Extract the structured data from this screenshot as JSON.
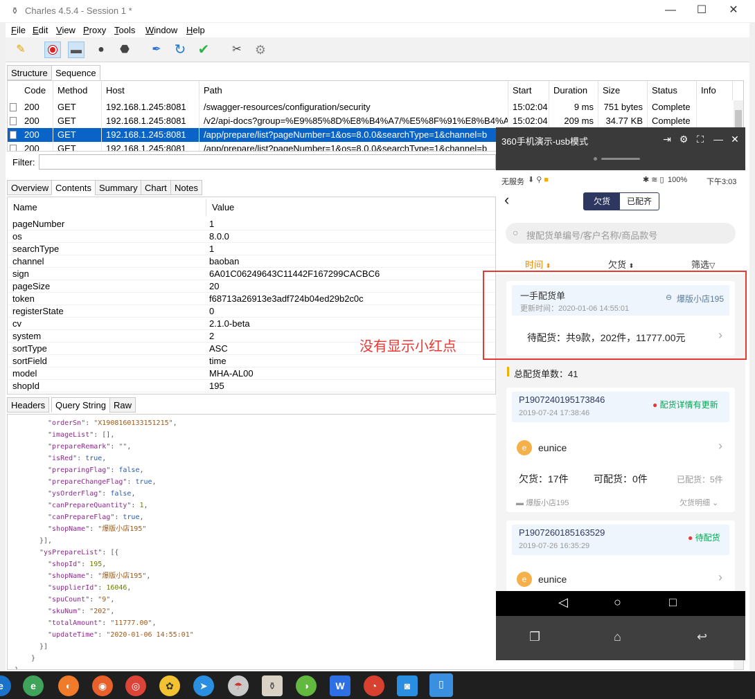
{
  "window": {
    "title": "Charles 4.5.4 - Session 1 *",
    "minimize": "—",
    "maximize": "☐",
    "close": "✕"
  },
  "menu": [
    {
      "key": "F",
      "rest": "ile"
    },
    {
      "key": "E",
      "rest": "dit"
    },
    {
      "key": "V",
      "rest": "iew"
    },
    {
      "key": "P",
      "rest": "roxy"
    },
    {
      "key": "T",
      "rest": "ools"
    },
    {
      "key": "W",
      "rest": "indow"
    },
    {
      "key": "H",
      "rest": "elp"
    }
  ],
  "top_tabs": [
    "Structure",
    "Sequence"
  ],
  "sequence": {
    "columns": [
      "Code",
      "Method",
      "Host",
      "Path",
      "Start",
      "Duration",
      "Size",
      "Status",
      "Info"
    ],
    "rows": [
      {
        "code": "200",
        "method": "GET",
        "host": "192.168.1.245:8081",
        "path": "/swagger-resources/configuration/security",
        "start": "15:02:04",
        "duration": "9 ms",
        "size": "751 bytes",
        "status": "Complete",
        "info": ""
      },
      {
        "code": "200",
        "method": "GET",
        "host": "192.168.1.245:8081",
        "path": "/v2/api-docs?group=%E9%85%8D%E8%B4%A7/%E5%8F%91%E8%B4%A7",
        "start": "15:02:04",
        "duration": "209 ms",
        "size": "34.77 KB",
        "status": "Complete",
        "info": ""
      },
      {
        "code": "200",
        "method": "GET",
        "host": "192.168.1.245:8081",
        "path": "/app/prepare/list?pageNumber=1&os=8.0.0&searchType=1&channel=b",
        "start": "",
        "duration": "",
        "size": "",
        "status": "",
        "info": ""
      },
      {
        "code": "200",
        "method": "GET",
        "host": "192.168.1.245:8081",
        "path": "/app/prepare/list?pageNumber=1&os=8.0.0&searchType=1&channel=b",
        "start": "",
        "duration": "",
        "size": "",
        "status": "",
        "info": ""
      }
    ]
  },
  "filter": {
    "label": "Filter:",
    "value": ""
  },
  "detail_tabs": [
    "Overview",
    "Contents",
    "Summary",
    "Chart",
    "Notes"
  ],
  "params": {
    "header_name": "Name",
    "header_value": "Value",
    "rows": [
      {
        "name": "pageNumber",
        "value": "1"
      },
      {
        "name": "os",
        "value": "8.0.0"
      },
      {
        "name": "searchType",
        "value": "1"
      },
      {
        "name": "channel",
        "value": "baoban"
      },
      {
        "name": "sign",
        "value": "6A01C06249643C11442F167299CACBC6"
      },
      {
        "name": "pageSize",
        "value": "20"
      },
      {
        "name": "token",
        "value": "f68713a26913e3adf724b04ed29b2c0c"
      },
      {
        "name": "registerState",
        "value": "0"
      },
      {
        "name": "cv",
        "value": "2.1.0-beta"
      },
      {
        "name": "system",
        "value": "2"
      },
      {
        "name": "sortType",
        "value": "ASC"
      },
      {
        "name": "sortField",
        "value": "time"
      },
      {
        "name": "model",
        "value": "MHA-AL00"
      },
      {
        "name": "shopId",
        "value": "195"
      }
    ]
  },
  "bottom_tabs": [
    "Headers",
    "Query String",
    "Raw"
  ],
  "json_lines": [
    {
      "indent": 4,
      "key": "orderSn",
      "val": "\"X1908160133151215\"",
      "type": "s",
      "tail": ","
    },
    {
      "indent": 4,
      "key": "imageList",
      "val": "[]",
      "type": "p",
      "tail": ","
    },
    {
      "indent": 4,
      "key": "prepareRemark",
      "val": "\"\"",
      "type": "s",
      "tail": ","
    },
    {
      "indent": 4,
      "key": "isRed",
      "val": "true",
      "type": "b",
      "tail": ","
    },
    {
      "indent": 4,
      "key": "preparingFlag",
      "val": "false",
      "type": "b",
      "tail": ","
    },
    {
      "indent": 4,
      "key": "prepareChangeFlag",
      "val": "true",
      "type": "b",
      "tail": ","
    },
    {
      "indent": 4,
      "key": "ysOrderFlag",
      "val": "false",
      "type": "b",
      "tail": ","
    },
    {
      "indent": 4,
      "key": "canPrepareQuantity",
      "val": "1",
      "type": "n",
      "tail": ","
    },
    {
      "indent": 4,
      "key": "canPrepareFlag",
      "val": "true",
      "type": "b",
      "tail": ","
    },
    {
      "indent": 4,
      "key": "shopName",
      "val": "\"爆版小店195\"",
      "type": "s",
      "tail": ""
    },
    {
      "indent": 3,
      "raw": "}],"
    },
    {
      "indent": 3,
      "key": "ysPrepareList",
      "val": "[{",
      "type": "p",
      "tail": ""
    },
    {
      "indent": 4,
      "key": "shopId",
      "val": "195",
      "type": "n",
      "tail": ","
    },
    {
      "indent": 4,
      "key": "shopName",
      "val": "\"爆版小店195\"",
      "type": "s",
      "tail": ","
    },
    {
      "indent": 4,
      "key": "supplierId",
      "val": "16046",
      "type": "n",
      "tail": ","
    },
    {
      "indent": 4,
      "key": "spuCount",
      "val": "\"9\"",
      "type": "s",
      "tail": ","
    },
    {
      "indent": 4,
      "key": "skuNum",
      "val": "\"202\"",
      "type": "s",
      "tail": ","
    },
    {
      "indent": 4,
      "key": "totalAmount",
      "val": "\"11777.00\"",
      "type": "s",
      "tail": ","
    },
    {
      "indent": 4,
      "key": "updateTime",
      "val": "\"2020-01-06 14:55:01\"",
      "type": "s",
      "tail": ""
    },
    {
      "indent": 3,
      "raw": "}]"
    },
    {
      "indent": 2,
      "raw": "}"
    },
    {
      "indent": 0,
      "raw": "}"
    }
  ],
  "phone": {
    "window_title": "360手机演示-usb模式",
    "status_left": "无服务",
    "status_battery": "100%",
    "status_time": "下午3:03",
    "toggle": [
      "欠货",
      "已配齐"
    ],
    "search_placeholder": "搜配货单编号/客户名称/商品款号",
    "filters": [
      "时间",
      "欠货",
      "筛选"
    ],
    "first_card": {
      "title": "一手配货单",
      "shop": "爆版小店195",
      "update_time": "更新时间：2020-01-06 14:55:01",
      "summary": "待配货：共9款，202件，11777.00元"
    },
    "total_label": "总配货单数：41",
    "orders": [
      {
        "id": "P1907240195173846",
        "date": "2019-07-24 17:38:46",
        "status": "配货详情有更新",
        "customer": "eunice",
        "owe": "欠货：17件",
        "can": "可配货：0件",
        "done": "已配货：5件",
        "shop": "爆版小店195",
        "detail": "欠货明细"
      },
      {
        "id": "P1907260185163529",
        "date": "2019-07-26 16:35:29",
        "status": "待配货",
        "customer": "eunice"
      }
    ]
  },
  "annotation": "没有显示小红点",
  "taskbar_icons": [
    "edge",
    "360se",
    "ie",
    "firefox",
    "chrome",
    "app-a",
    "app-b",
    "app-c",
    "app-d",
    "app-e",
    "wps",
    "app-f",
    "app-g",
    "phone"
  ],
  "colors": {
    "selection": "#0a64c8",
    "accent_orange": "#f08a00",
    "alert_red": "#e53935",
    "status_green": "#00a853",
    "dark_nav": "#2d3760"
  }
}
